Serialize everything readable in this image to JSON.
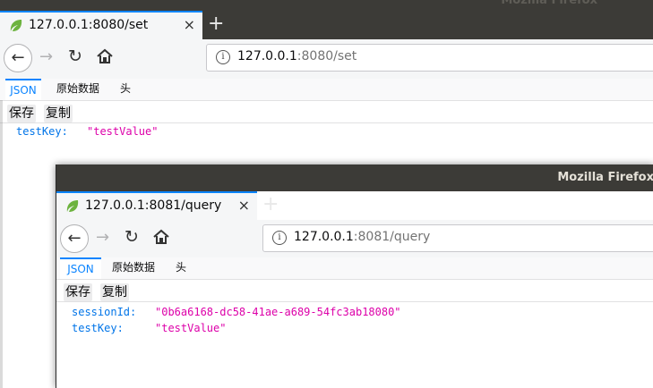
{
  "window1": {
    "title": "Mozilla Firefox",
    "tab_title": "127.0.0.1:8080/set",
    "tab_close": "×",
    "new_tab": "+",
    "url_host": "127.0.0.1",
    "url_path": ":8080/set",
    "viewer_tabs": [
      "JSON",
      "原始数据",
      "头"
    ],
    "buttons": [
      "保存",
      "复制"
    ],
    "json": [
      {
        "key": "testKey:",
        "value": "\"testValue\""
      }
    ]
  },
  "window2": {
    "title": "Mozilla Firefox",
    "tab_title": "127.0.0.1:8081/query",
    "tab_close": "×",
    "new_tab": "+",
    "url_host": "127.0.0.1",
    "url_path": ":8081/query",
    "viewer_tabs": [
      "JSON",
      "原始数据",
      "头"
    ],
    "buttons": [
      "保存",
      "复制"
    ],
    "json": [
      {
        "key": "sessionId:",
        "value": "\"0b6a6168-dc58-41ae-a689-54fc3ab18080\""
      },
      {
        "key": "testKey:",
        "value": "\"testValue\""
      }
    ]
  },
  "colors": {
    "accent": "#0a84ff",
    "json_key": "#0074e8",
    "json_string": "#dd00a9",
    "titlebar": "#3c3b37"
  },
  "icons": {
    "favicon": "spring-leaf-icon",
    "back": "back-arrow-icon",
    "forward": "forward-arrow-icon",
    "reload": "reload-icon",
    "home": "home-icon",
    "info": "info-icon"
  }
}
